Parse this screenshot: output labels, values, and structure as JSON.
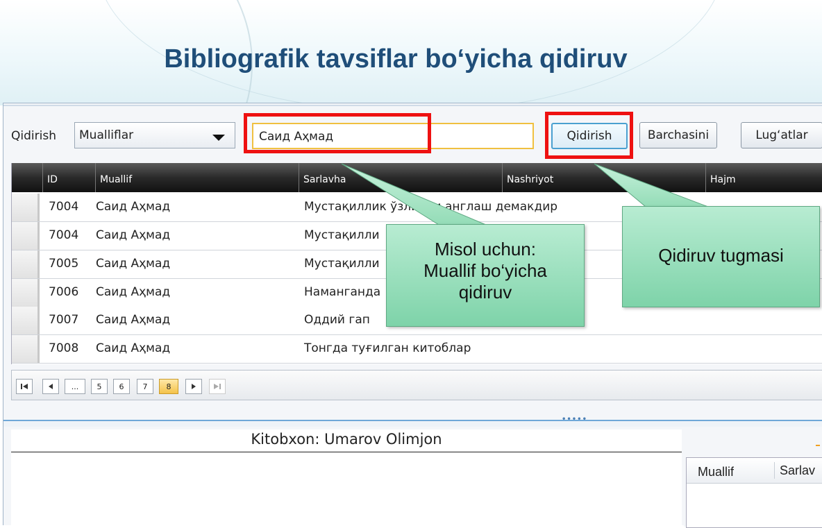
{
  "slide": {
    "title": "Bibliografik tavsiflar bo‘yicha qidiruv"
  },
  "toolbar": {
    "search_label": "Qidirish",
    "combo_value": "Mualliflar",
    "search_value": "Саид Аҳмад",
    "search_button": "Qidirish",
    "all_button": "Barchasini",
    "dict_button": "Lug‘atlar"
  },
  "grid": {
    "columns": [
      "ID",
      "Muallif",
      "Sarlavha",
      "Nashriyot",
      "Hajm"
    ],
    "rows": [
      {
        "id": "7004",
        "author": "Саид Аҳмад",
        "title": "Мустақиллик ўзликни англаш демакдир"
      },
      {
        "id": "7004",
        "author": "Саид Аҳмад",
        "title": "Мустақилли"
      },
      {
        "id": "7005",
        "author": "Саид Аҳмад",
        "title": "Мустақилли"
      },
      {
        "id": "7006",
        "author": "Саид Аҳмад",
        "title": "Наманганда"
      },
      {
        "id": "7007",
        "author": "Саид Аҳмад",
        "title": "Оддий гап"
      },
      {
        "id": "7008",
        "author": "Саид Аҳмад",
        "title": "Тонгда туғилган китоблар"
      }
    ]
  },
  "pager": {
    "pages": [
      "...",
      "5",
      "6",
      "7",
      "8"
    ],
    "current_page": "8",
    "first_icon": "first-page-icon",
    "prev_icon": "previous-page-icon",
    "next_icon": "next-page-icon",
    "last_icon": "last-page-icon"
  },
  "reader": {
    "title": "Kitobxon: Umarov Olimjon"
  },
  "side_grid": {
    "columns": [
      "Muallif",
      "Sarlav"
    ]
  },
  "callouts": {
    "author_search": [
      "Misol uchun:",
      "Muallif bo‘yicha",
      "qidiruv"
    ],
    "search_button": "Qidiruv tugmasi"
  },
  "colors": {
    "title": "#1f4e79",
    "highlight": "#ee1111",
    "callout": "#7ed3a9",
    "active_page": "#f4c24a"
  }
}
